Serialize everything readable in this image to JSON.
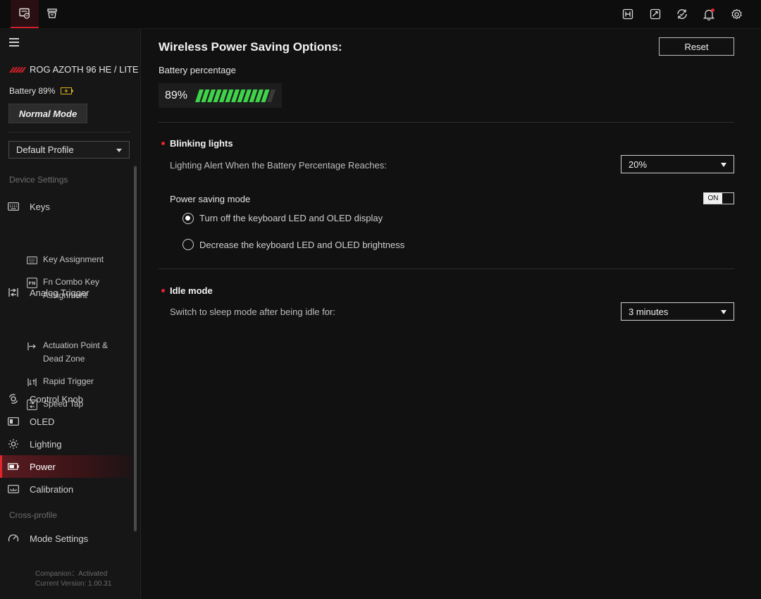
{
  "topbar": {
    "left_icons": [
      "device-dashboard-icon",
      "device-list-icon"
    ],
    "right_icons": [
      "hotkey-icon",
      "screen-capture-icon",
      "sync-icon",
      "bell-icon",
      "gear-icon"
    ]
  },
  "sidebar": {
    "device_name": "ROG AZOTH 96 HE / LITE",
    "battery_text": "Battery 89%",
    "mode_button": "Normal Mode",
    "profile": "Default Profile",
    "device_settings_label": "Device Settings",
    "nav": {
      "keys": "Keys",
      "key_assignment": "Key Assignment",
      "fn_combo": "Fn Combo Key Assignment",
      "analog_trigger": "Analog Trigger",
      "actuation": "Actuation Point & Dead Zone",
      "rapid_trigger": "Rapid Trigger",
      "speed_tap": "Speed Tap",
      "control_knob": "Control Knob",
      "oled": "OLED",
      "lighting": "Lighting",
      "power": "Power",
      "calibration": "Calibration"
    },
    "cross_profile_label": "Cross-profile",
    "mode_settings": "Mode Settings",
    "companion_status": "Companion：Activated",
    "current_version": "Current Version: 1.00.31"
  },
  "main": {
    "title": "Wireless Power Saving Options:",
    "reset_label": "Reset",
    "battery_label": "Battery percentage",
    "battery_value": "89%",
    "battery_level": 0.89,
    "blinking": {
      "title": "Blinking lights",
      "alert_text": "Lighting Alert When the Battery Percentage Reaches:",
      "alert_value": "20%"
    },
    "power_saving": {
      "label": "Power saving mode",
      "toggle_label": "ON",
      "option_1": "Turn off the keyboard LED and OLED display",
      "option_2": "Decrease the keyboard LED and OLED brightness",
      "selected": 1
    },
    "idle": {
      "title": "Idle mode",
      "sleep_text": "Switch to sleep mode after being idle for:",
      "sleep_value": "3 minutes"
    }
  },
  "colors": {
    "accent": "#e1262d",
    "battery_green": "#3fd34a",
    "background": "#111111",
    "sidebar": "#161616"
  }
}
